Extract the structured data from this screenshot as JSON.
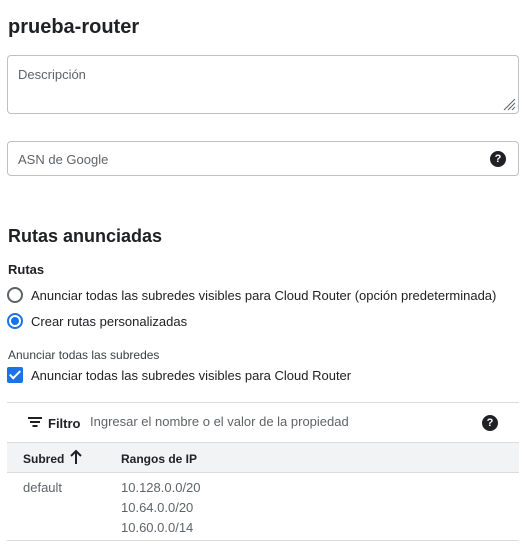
{
  "title": "prueba-router",
  "description_field": {
    "placeholder": "Descripción"
  },
  "asn_field": {
    "placeholder": "ASN de Google",
    "help_icon": "help-icon"
  },
  "advertised_routes": {
    "title": "Rutas anunciadas",
    "routes_label": "Rutas",
    "options": [
      {
        "label": "Anunciar todas las subredes visibles para Cloud Router (opción predeterminada)",
        "checked": false
      },
      {
        "label": "Crear rutas personalizadas",
        "checked": true
      }
    ],
    "subnets_label": "Anunciar todas las subredes",
    "subnets_checkbox": {
      "label": "Anunciar todas las subredes visibles para Cloud Router",
      "checked": true
    }
  },
  "filter": {
    "label": "Filtro",
    "placeholder": "Ingresar el nombre o el valor de la propiedad"
  },
  "table": {
    "columns": [
      "Subred",
      "Rangos de IP"
    ],
    "sort_column": "Subred",
    "sort_direction": "ascending",
    "rows": [
      {
        "subnet": "default",
        "ranges": [
          "10.128.0.0/20",
          "10.64.0.0/20",
          "10.60.0.0/14"
        ]
      }
    ]
  },
  "colors": {
    "accent": "#1a73e8",
    "header_bg": "#f1f3f4",
    "border": "#dadce0"
  }
}
